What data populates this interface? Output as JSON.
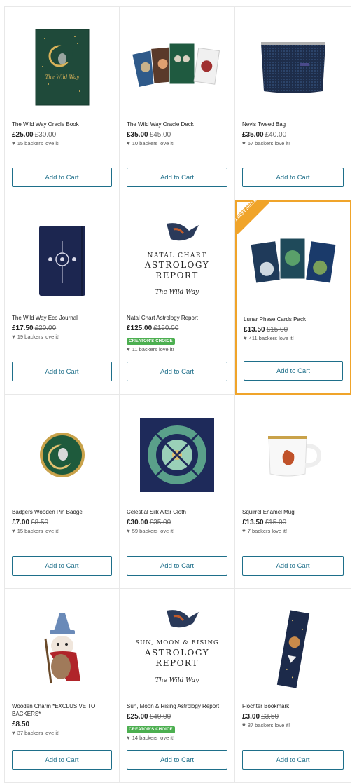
{
  "button_label": "Add to Cart",
  "accent_color": "#1e6f8a",
  "ribbon": "#1 BEST SELLER",
  "products": [
    {
      "name": "The Wild Way Oracle Book",
      "price": "£25.00",
      "old_price": "£30.00",
      "backers": "15 backers love it!",
      "icon": "book-icon",
      "badge": ""
    },
    {
      "name": "The Wild Way Oracle Deck",
      "price": "£35.00",
      "old_price": "£45.00",
      "backers": "10 backers love it!",
      "icon": "cards-icon",
      "badge": ""
    },
    {
      "name": "Nevis Tweed Bag",
      "price": "£35.00",
      "old_price": "£40.00",
      "backers": "67 backers love it!",
      "icon": "bag-icon",
      "badge": ""
    },
    {
      "name": "The Wild Way Eco Journal",
      "price": "£17.50",
      "old_price": "£20.00",
      "backers": "19 backers love it!",
      "icon": "journal-icon",
      "badge": ""
    },
    {
      "name": "Natal Chart Astrology Report",
      "price": "£125.00",
      "old_price": "£150.00",
      "backers": "11 backers love it!",
      "icon": "report-icon",
      "badge": "CREATOR'S CHOICE"
    },
    {
      "name": "Lunar Phase Cards Pack",
      "price": "£13.50",
      "old_price": "£15.00",
      "backers": "411 backers love it!",
      "icon": "cards-icon",
      "badge": ""
    },
    {
      "name": "Badgers Wooden Pin Badge",
      "price": "£7.00",
      "old_price": "£8.50",
      "backers": "15 backers love it!",
      "icon": "pin-badge-icon",
      "badge": ""
    },
    {
      "name": "Celestial Silk Altar Cloth",
      "price": "£30.00",
      "old_price": "£35.00",
      "backers": "59 backers love it!",
      "icon": "altar-cloth-icon",
      "badge": ""
    },
    {
      "name": "Squirrel Enamel Mug",
      "price": "£13.50",
      "old_price": "£15.00",
      "backers": "7 backers love it!",
      "icon": "mug-icon",
      "badge": ""
    },
    {
      "name": "Wooden Charm *EXCLUSIVE TO BACKERS*",
      "price": "£8.50",
      "old_price": "",
      "backers": "37 backers love it!",
      "icon": "charm-icon",
      "badge": ""
    },
    {
      "name": "Sun, Moon & Rising Astrology Report",
      "price": "£25.00",
      "old_price": "£40.00",
      "backers": "14 backers love it!",
      "icon": "report-icon",
      "badge": "CREATOR'S CHOICE"
    },
    {
      "name": "Flochter Bookmark",
      "price": "£3.00",
      "old_price": "£3.50",
      "backers": "87 backers love it!",
      "icon": "bookmark-icon",
      "badge": ""
    }
  ],
  "report_art": {
    "natal": {
      "line1": "NATAL CHART",
      "line2": "ASTROLOGY",
      "line3": "REPORT",
      "brand": "The Wild Way"
    },
    "sun": {
      "line1": "SUN, MOON & RISING",
      "line2": "ASTROLOGY",
      "line3": "REPORT",
      "brand": "The Wild Way"
    },
    "book_title": "The Wild Way"
  }
}
